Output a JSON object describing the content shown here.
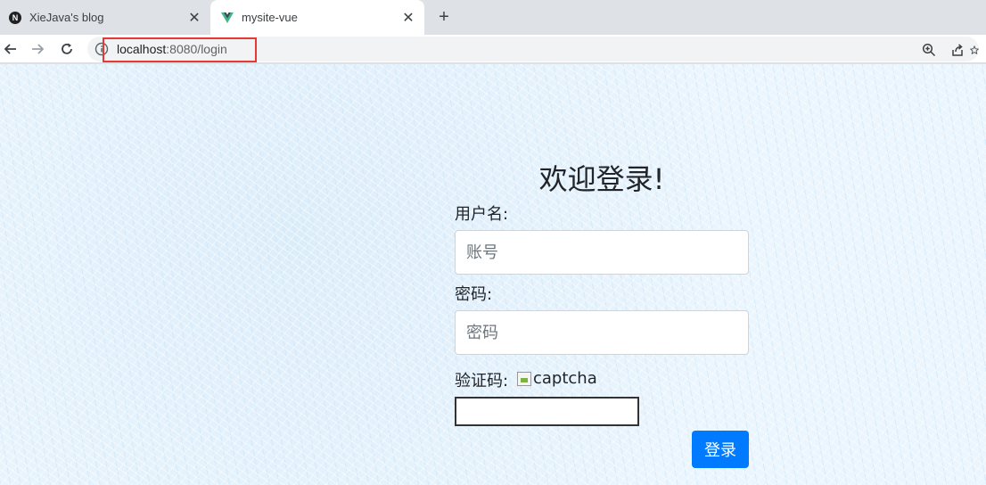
{
  "browser": {
    "tabs": [
      {
        "title": "XieJava's blog",
        "active": false
      },
      {
        "title": "mysite-vue",
        "active": true
      }
    ],
    "address": {
      "host": "localhost",
      "rest": ":8080/login"
    }
  },
  "login": {
    "title": "欢迎登录!",
    "username_label": "用户名:",
    "username_placeholder": "账号",
    "password_label": "密码:",
    "password_placeholder": "密码",
    "captcha_label": "验证码:",
    "captcha_alt": "captcha",
    "submit_label": "登录"
  },
  "colors": {
    "accent": "#007bff",
    "highlight_box": "#e53935"
  }
}
